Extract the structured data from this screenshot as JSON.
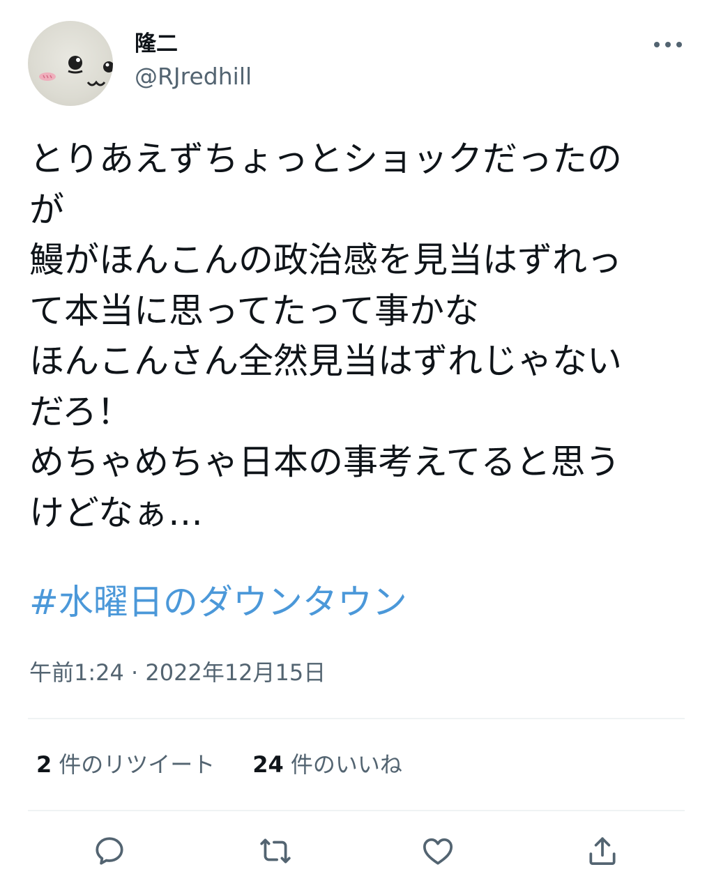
{
  "author": {
    "display_name": "隆二",
    "handle": "@RJredhill"
  },
  "tweet": {
    "lines": [
      "とりあえずちょっとショックだったの",
      "が",
      "鰻がほんこんの政治感を見当はずれっ",
      "て本当に思ってたって事かな",
      "ほんこんさん全然見当はずれじゃない",
      "だろ！",
      "めちゃめちゃ日本の事考えてると思う",
      "けどなぁ…"
    ],
    "hashtag": "#水曜日のダウンタウン",
    "timestamp": "午前1:24 · 2022年12月15日"
  },
  "stats": {
    "retweets": {
      "count": "2",
      "label": "件のリツイート"
    },
    "likes": {
      "count": "24",
      "label": "件のいいね"
    }
  },
  "icons": {
    "more": "more-horizontal-icon",
    "reply": "reply-icon",
    "retweet": "retweet-icon",
    "like": "heart-icon",
    "share": "share-icon"
  },
  "colors": {
    "text": "#0f1419",
    "secondary": "#536471",
    "hashtag": "#4b98d9",
    "divider": "#eff3f4"
  }
}
